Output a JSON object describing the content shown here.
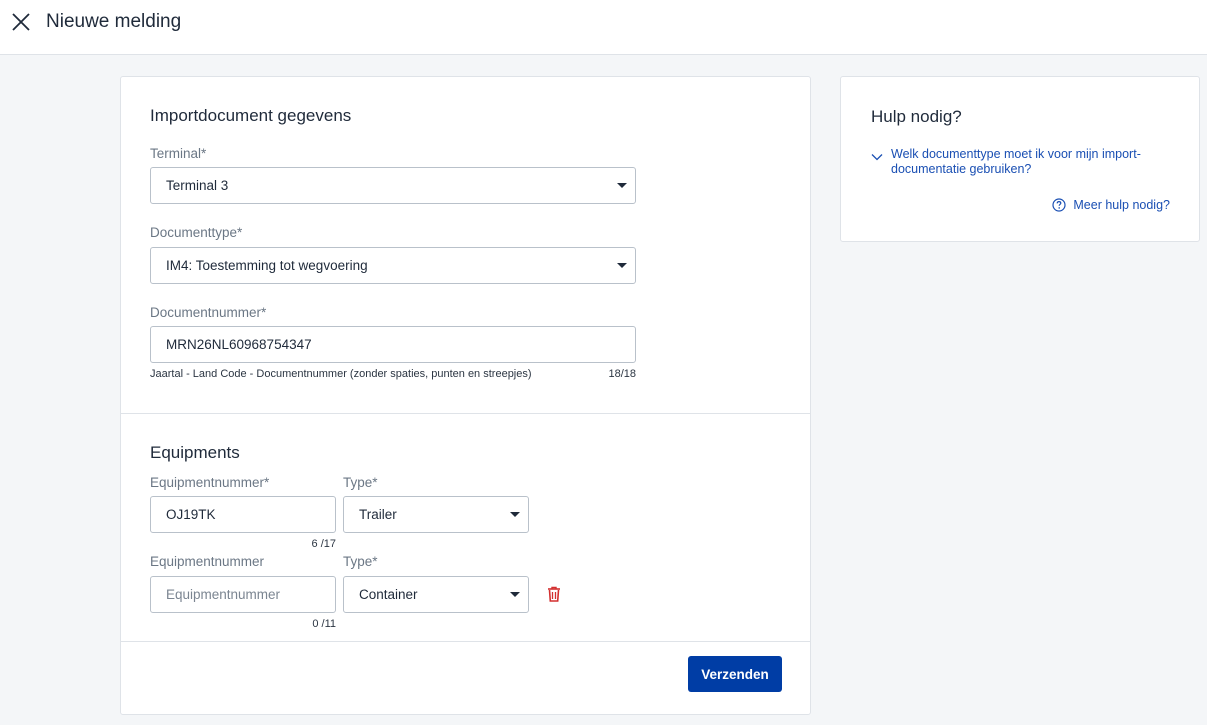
{
  "header": {
    "title": "Nieuwe melding",
    "close_icon": "close-icon"
  },
  "form": {
    "import_section": {
      "title": "Importdocument gegevens",
      "terminal": {
        "label": "Terminal*",
        "value": "Terminal 3"
      },
      "document_type": {
        "label": "Documenttype*",
        "value": "IM4: Toestemming tot wegvoering"
      },
      "document_number": {
        "label": "Documentnummer*",
        "value": "MRN26NL60968754347",
        "hint": "Jaartal - Land Code - Documentnummer (zonder spaties, punten en streepjes)",
        "counter": "18/18"
      }
    },
    "equipments": {
      "title": "Equipments",
      "rows": [
        {
          "number_label": "Equipmentnummer*",
          "number_value": "OJ19TK",
          "number_placeholder": "",
          "counter": "6 /17",
          "type_label": "Type*",
          "type_value": "Trailer"
        },
        {
          "number_label": "Equipmentnummer",
          "number_value": "",
          "number_placeholder": "Equipmentnummer",
          "counter": "0 /11",
          "type_label": "Type*",
          "type_value": "Container",
          "delete_icon": "trash-icon"
        }
      ]
    },
    "submit_label": "Verzenden"
  },
  "help": {
    "title": "Hulp nodig?",
    "faq_question": "Welk documenttype moet ik voor mijn import-documentatie gebruiken?",
    "more_help_label": "Meer hulp nodig?",
    "more_help_icon": "question-circle-icon"
  },
  "colors": {
    "primary": "#003da5",
    "link": "#1a4fb3",
    "danger": "#d32f2f",
    "background": "#f4f6f8"
  }
}
